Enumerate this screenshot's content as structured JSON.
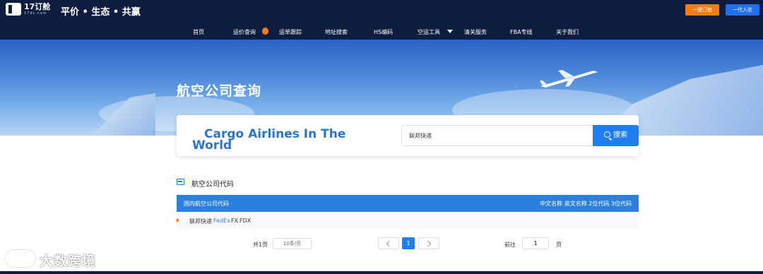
{
  "header": {
    "brand": "17订舱",
    "brand_sub": "17dc.com",
    "slogan": "平价 • 生态 • 共赢",
    "btn_orange": "一键订舱",
    "btn_blue": "一代入驻",
    "colors": {
      "bg": "#0e1c3f",
      "orange": "#f07d1a",
      "blue": "#1f6ff0"
    }
  },
  "nav": {
    "items": [
      {
        "label": "首页"
      },
      {
        "label": "运价查询"
      },
      {
        "label": "运单跟踪"
      },
      {
        "label": "地址搜索"
      },
      {
        "label": "HS编码"
      },
      {
        "label": "空运工具"
      },
      {
        "label": "清关服务"
      },
      {
        "label": "FBA专线"
      },
      {
        "label": "关于我们"
      }
    ],
    "icons": {
      "rate_badge": "fire-icon",
      "tools_dropdown": "caret-down-icon"
    }
  },
  "banner": {
    "title": "航空公司查询"
  },
  "search": {
    "title_line1": "Cargo Airlines In The",
    "title_line2": "World",
    "value": "联邦快递",
    "button": "搜索"
  },
  "section": {
    "title": "航空公司代码"
  },
  "table": {
    "head_left": "国内航空公司代码",
    "head_right": "中文名称 英文名称 2位代码 3位代码",
    "rows": [
      {
        "cn": "联邦快递",
        "en": "FedEx",
        "code2": "FX",
        "code3": "FDX"
      }
    ]
  },
  "pagination": {
    "total": "共1页",
    "page_size": "10条/页",
    "current": "1",
    "goto_label": "前往",
    "goto_value": "1",
    "page_unit": "页"
  },
  "watermark": {
    "text": "大数跨境"
  }
}
